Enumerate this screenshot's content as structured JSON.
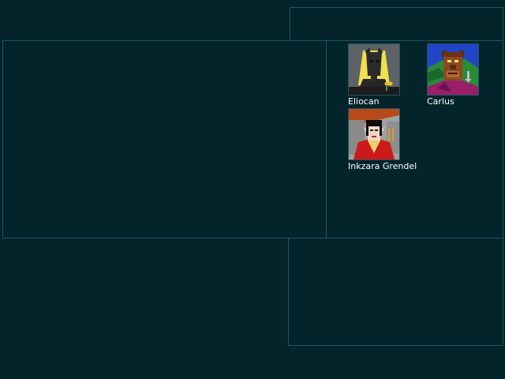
{
  "party": {
    "members": [
      {
        "name": "Eliocan",
        "portrait_icon": "dark-elf-portrait-icon"
      },
      {
        "name": "Carlus",
        "portrait_icon": "beastman-portrait-icon"
      },
      {
        "name": "Inkzara Grendel",
        "portrait_icon": "elf-noble-portrait-icon"
      }
    ]
  },
  "colors": {
    "background": "#02242a",
    "frame_border": "#1e5664",
    "text": "#ffffff"
  }
}
